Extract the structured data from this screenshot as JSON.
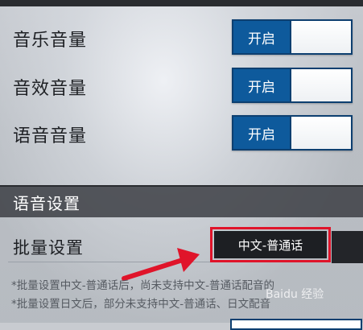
{
  "volume_settings": [
    {
      "label": "音乐音量",
      "toggle": "开启"
    },
    {
      "label": "音效音量",
      "toggle": "开启"
    },
    {
      "label": "语音音量",
      "toggle": "开启"
    }
  ],
  "voice_section": {
    "title": "语音设置",
    "batch_label": "批量设置",
    "batch_option": "中文-普通话",
    "notes": [
      "*批量设置中文-普通话后，尚未支持中文-普通话配音的",
      "*批量设置日文后，部分未支持中文-普通话、日文配音"
    ]
  },
  "watermark": "Baidu 经验",
  "colors": {
    "toggle_on": "#0e5a9c",
    "highlight": "#e0142a",
    "section_header": "#3c3e44"
  }
}
